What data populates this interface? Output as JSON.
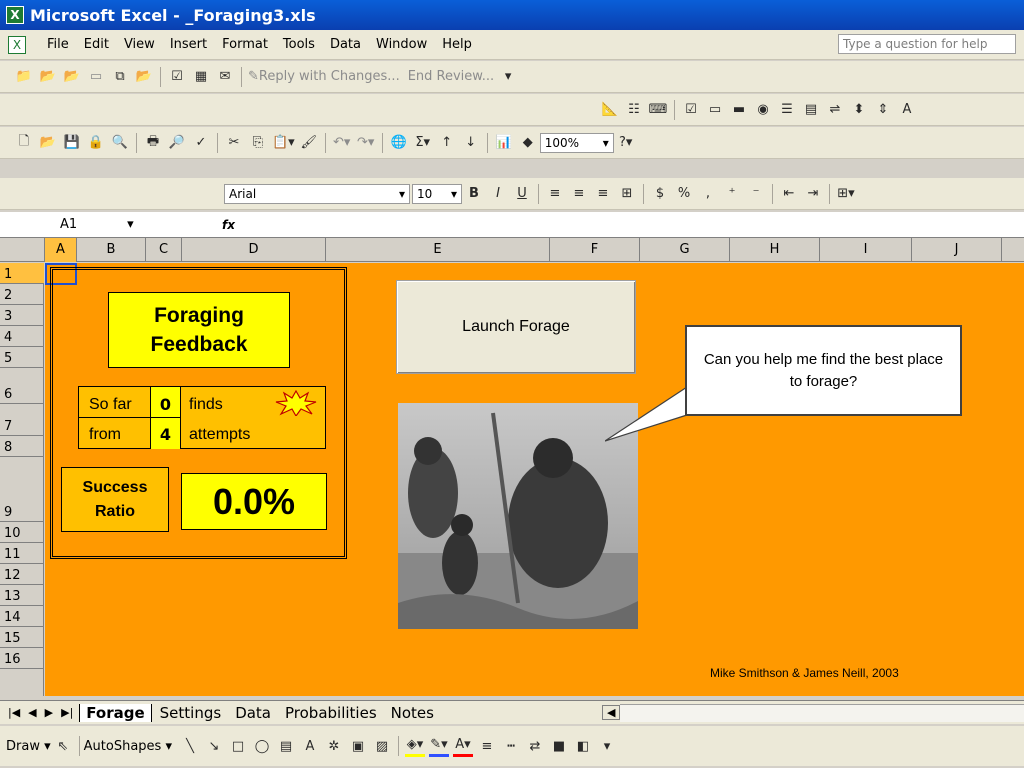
{
  "window": {
    "title": "Microsoft Excel - _Foraging3.xls"
  },
  "menu": {
    "items": [
      "File",
      "Edit",
      "View",
      "Insert",
      "Format",
      "Tools",
      "Data",
      "Window",
      "Help"
    ],
    "help_placeholder": "Type a question for help"
  },
  "reviewing": {
    "reply": "Reply with Changes...",
    "end": "End Review..."
  },
  "standard": {
    "zoom": "100%"
  },
  "formatting": {
    "font": "Arial",
    "size": "10"
  },
  "formula": {
    "cell": "A1",
    "fx": "fx"
  },
  "columns": [
    "A",
    "B",
    "C",
    "D",
    "E",
    "F",
    "G",
    "H",
    "I",
    "J"
  ],
  "rows": [
    "1",
    "2",
    "3",
    "4",
    "5",
    "6",
    "7",
    "8",
    "9",
    "10",
    "11",
    "12",
    "13",
    "14",
    "15",
    "16"
  ],
  "sheet": {
    "feedback_title": "Foraging Feedback",
    "so_far": "So far",
    "finds_value": "0",
    "finds": "finds",
    "from": "from",
    "attempts_value": "4",
    "attempts": "attempts",
    "success_ratio": "Success Ratio",
    "ratio_value": "0.0%",
    "launch_button": "Launch Forage",
    "callout": "Can you help me find the best place to forage?",
    "credit": "Mike Smithson & James Neill, 2003"
  },
  "tabs": [
    "Forage",
    "Settings",
    "Data",
    "Probabilities",
    "Notes"
  ],
  "draw": {
    "draw": "Draw",
    "autoshapes": "AutoShapes"
  }
}
